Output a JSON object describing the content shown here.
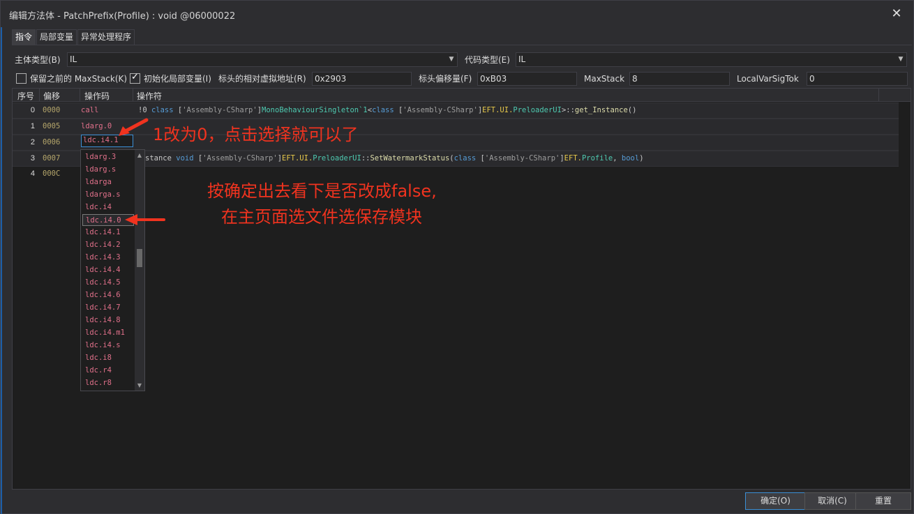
{
  "window": {
    "title": "编辑方法体 - PatchPrefix(Profile) : void @06000022",
    "close_glyph": "✕"
  },
  "tabs": [
    {
      "label": "指令",
      "active": true
    },
    {
      "label": "局部变量",
      "active": false
    },
    {
      "label": "异常处理程序",
      "active": false
    }
  ],
  "body_type": {
    "label": "主体类型(B)",
    "value": "IL"
  },
  "code_type": {
    "label": "代码类型(E)",
    "value": "IL"
  },
  "options": {
    "keep_maxstack": {
      "label": "保留之前的 MaxStack(K)",
      "checked": false
    },
    "init_locals": {
      "label": "初始化局部变量(I)",
      "checked": true
    },
    "rva": {
      "label": "标头的相对虚拟地址(R)",
      "value": "0x2903"
    },
    "header_offset": {
      "label": "标头偏移量(F)",
      "value": "0xB03"
    },
    "maxstack": {
      "label": "MaxStack",
      "value": "8"
    },
    "localvarsigtok": {
      "label": "LocalVarSigTok",
      "value": "0"
    }
  },
  "grid": {
    "columns": [
      "序号",
      "偏移",
      "操作码",
      "操作符"
    ],
    "rows": [
      {
        "index": "0",
        "offset": "0000",
        "opcode": "call"
      },
      {
        "index": "1",
        "offset": "0005",
        "opcode": "ldarg.0"
      },
      {
        "index": "2",
        "offset": "0006",
        "opcode": "ldc.i4.1"
      },
      {
        "index": "3",
        "offset": "0007",
        "opcode": ""
      },
      {
        "index": "4",
        "offset": "000C",
        "opcode": ""
      }
    ],
    "row0_operand": {
      "p1": "!0 ",
      "kw1": "class",
      "p2": " [",
      "asm1": "'Assembly-CSharp'",
      "p3": "]",
      "type1": "MonoBehaviourSingleton`1",
      "p4": "<",
      "kw2": "class",
      "p5": " [",
      "asm2": "'Assembly-CSharp'",
      "p6": "]",
      "ns1": "EFT.UI.",
      "type2": "PreloaderUI",
      "p7": ">::",
      "meth1": "get_Instance",
      "p8": "()"
    },
    "row3_operand": {
      "p1": "stance ",
      "kw1": "void",
      "p2": " [",
      "asm1": "'Assembly-CSharp'",
      "p3": "]",
      "ns1": "EFT.UI.",
      "type1": "PreloaderUI",
      "p4": "::",
      "meth1": "SetWatermarkStatus",
      "p5": "(",
      "kw2": "class",
      "p6": " [",
      "asm2": "'Assembly-CSharp'",
      "p7": "]",
      "ns2": "EFT.",
      "type2": "Profile",
      "p8": ", ",
      "kw3": "bool",
      "p9": ")"
    }
  },
  "dropdown": {
    "items": [
      "ldarg.3",
      "ldarg.s",
      "ldarga",
      "ldarga.s",
      "ldc.i4",
      "ldc.i4.0",
      "ldc.i4.1",
      "ldc.i4.2",
      "ldc.i4.3",
      "ldc.i4.4",
      "ldc.i4.5",
      "ldc.i4.6",
      "ldc.i4.7",
      "ldc.i4.8",
      "ldc.i4.m1",
      "ldc.i4.s",
      "ldc.i8",
      "ldc.r4",
      "ldc.r8"
    ],
    "selected": "ldc.i4.0"
  },
  "annotations": {
    "note1": "1改为0，点击选择就可以了",
    "note2_line1": "按确定出去看下是否改成false,",
    "note2_line2": "在主页面选文件选保存模块",
    "color": "#f0331f"
  },
  "buttons": {
    "ok": "确定(O)",
    "cancel": "取消(C)",
    "reset": "重置"
  }
}
